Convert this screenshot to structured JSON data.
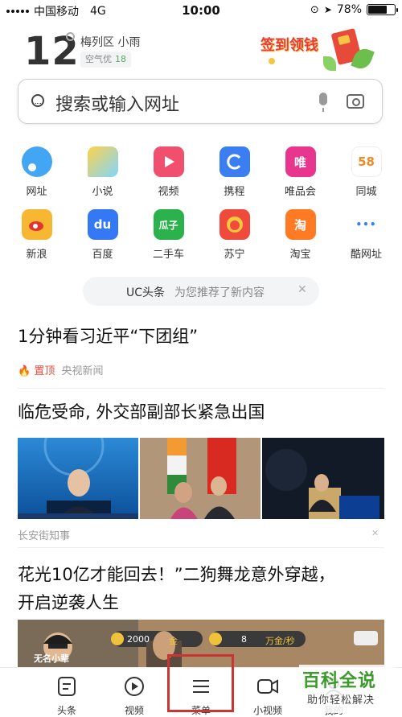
{
  "status_bar": {
    "carrier": "中国移动",
    "network": "4G",
    "time": "10:00",
    "battery": "78%",
    "battery_level": 0.78
  },
  "weather": {
    "temp": "12",
    "location": "梅列区 小雨",
    "aqi_label": "空气优",
    "aqi_value": "18"
  },
  "banner": {
    "text": "签到领钱"
  },
  "search": {
    "placeholder": "搜索或输入网址"
  },
  "shortcuts": [
    {
      "label": "网址",
      "icon": "circle-dot-icon",
      "color": "#43a6f5"
    },
    {
      "label": "小说",
      "icon": "speech-bubble-icon",
      "color": "#ffc93d"
    },
    {
      "label": "视频",
      "icon": "play-icon",
      "color": "#f0506e"
    },
    {
      "label": "携程",
      "icon": "ctrip-icon",
      "color": "#3a7ef2"
    },
    {
      "label": "唯品会",
      "icon": "vip-icon",
      "glyph": "唯",
      "color": "#e8358e"
    },
    {
      "label": "同城",
      "icon": "58-icon",
      "glyph": "58",
      "color": "#ffffff"
    },
    {
      "label": "新浪",
      "icon": "weibo-icon",
      "color": "#f7b733"
    },
    {
      "label": "百度",
      "icon": "baidu-paw-icon",
      "glyph": "du",
      "color": "#3578f6"
    },
    {
      "label": "二手车",
      "icon": "guazi-icon",
      "glyph": "瓜子",
      "color": "#2bb24c"
    },
    {
      "label": "苏宁",
      "icon": "lion-icon",
      "color": "#f04a3d"
    },
    {
      "label": "淘宝",
      "icon": "taobao-icon",
      "glyph": "淘",
      "color": "#ff7a23"
    },
    {
      "label": "酷网址",
      "icon": "more-dots-icon",
      "glyph": "•••",
      "color": "#ffffff"
    }
  ],
  "notice": {
    "source": "UC头条",
    "text": "为您推荐了新内容"
  },
  "news": [
    {
      "title": "1分钟看习近平“下团组”",
      "flag": "置顶",
      "source": "央视新闻"
    },
    {
      "title": "临危受命, 外交部副部长紧急出国",
      "source": "长安街知事"
    },
    {
      "title_line1": "花光10亿才能回去！”二狗舞龙意外穿越，",
      "title_line2": "开启逆袭人生",
      "game": {
        "char_name": "无名小辈",
        "gold": "2000",
        "gold_unit": "金",
        "rate": "8",
        "rate_unit": "万金/秒"
      }
    }
  ],
  "bottom_nav": [
    {
      "label": "头条",
      "icon": "news-icon"
    },
    {
      "label": "视频",
      "icon": "play-circle-icon"
    },
    {
      "label": "菜单",
      "icon": "menu-icon"
    },
    {
      "label": "小视频",
      "icon": "small-video-icon"
    },
    {
      "label": "我的",
      "icon": "profile-icon"
    }
  ],
  "watermark": {
    "line1": "百科全说",
    "line2": "助你轻松解决"
  }
}
